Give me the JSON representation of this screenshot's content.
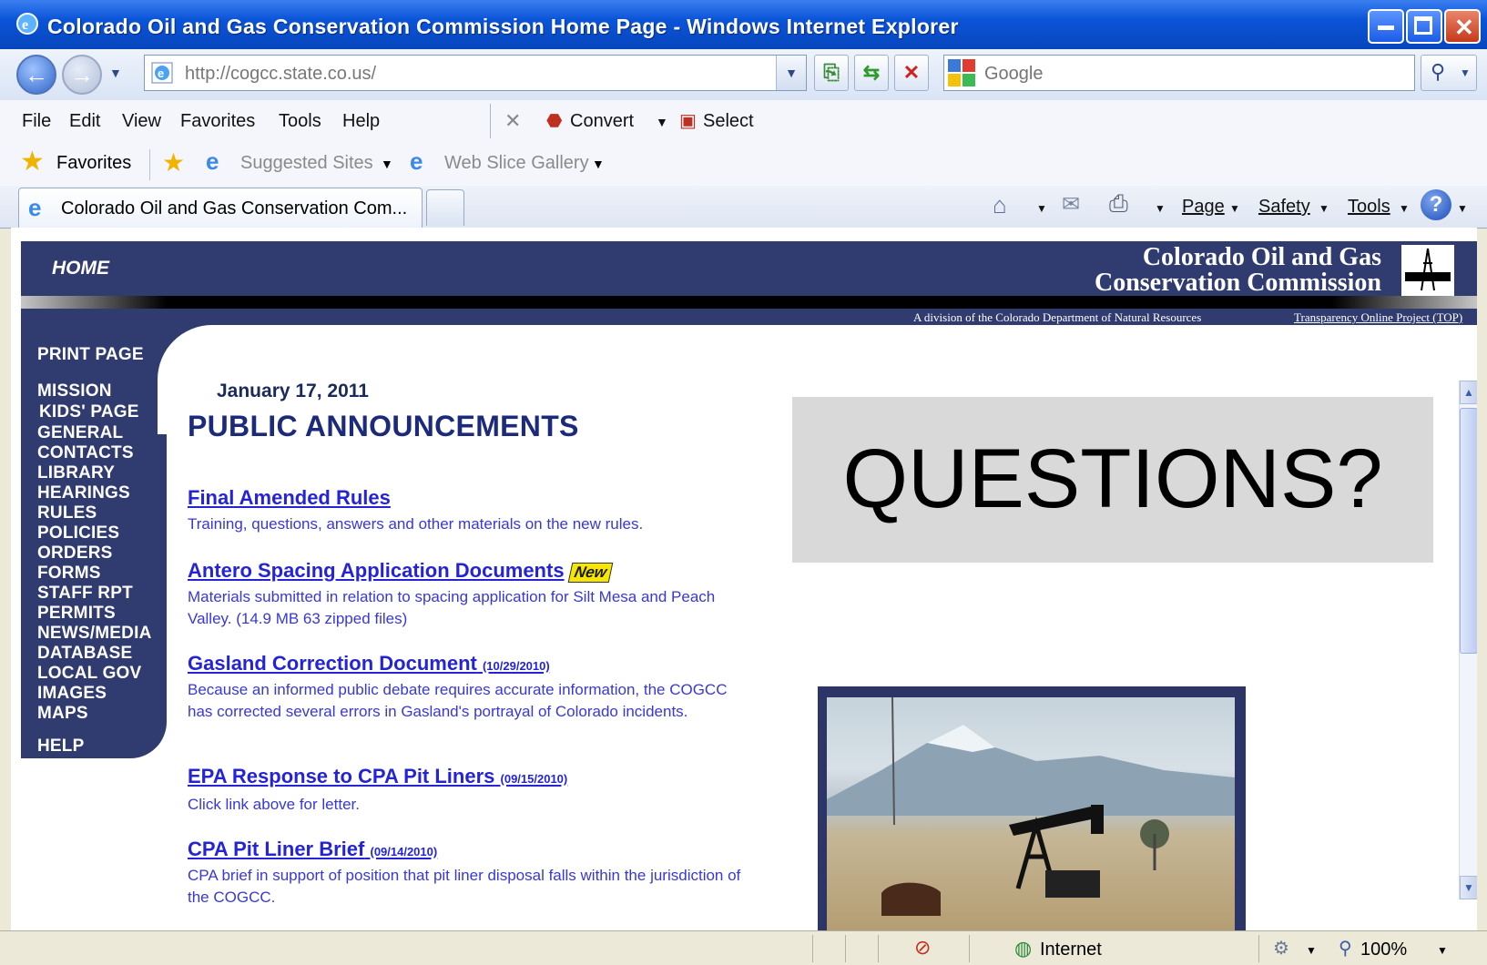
{
  "window": {
    "title": "Colorado Oil and Gas Conservation Commission Home Page - Windows Internet Explorer"
  },
  "address": {
    "url": "http://cogcc.state.co.us/",
    "search_placeholder": "Google"
  },
  "menu": [
    "File",
    "Edit",
    "View",
    "Favorites",
    "Tools",
    "Help"
  ],
  "toolbar2": {
    "convert": "Convert",
    "select": "Select"
  },
  "favorites_bar": {
    "favorites": "Favorites",
    "suggested": "Suggested Sites",
    "webslice": "Web Slice Gallery"
  },
  "tab": {
    "label": "Colorado Oil and Gas Conservation Com..."
  },
  "commandbar": {
    "page": "Page",
    "safety": "Safety",
    "tools": "Tools"
  },
  "banner": {
    "home": "HOME",
    "org_line1": "Colorado Oil and Gas",
    "org_line2": "Conservation Commission",
    "division": "A division of the Colorado Department of Natural Resources",
    "top_link": "Transparency Online Project (TOP)"
  },
  "sidenav": [
    "PRINT PAGE",
    "MISSION",
    "KIDS' PAGE",
    "GENERAL",
    "CONTACTS",
    "LIBRARY",
    "HEARINGS",
    "RULES",
    "POLICIES",
    "ORDERS",
    "FORMS",
    "STAFF RPT",
    "PERMITS",
    "NEWS/MEDIA",
    "DATABASE",
    "LOCAL GOV",
    "IMAGES",
    "MAPS",
    "HELP"
  ],
  "main": {
    "date": "January 17, 2011",
    "title": "PUBLIC ANNOUNCEMENTS",
    "items": [
      {
        "link": "Final Amended Rules",
        "date": "",
        "desc": "Training, questions, answers and other materials on the new rules."
      },
      {
        "link": "Antero Spacing Application Documents",
        "date": "",
        "badge": "New",
        "desc": "Materials submitted in relation to spacing application for Silt Mesa and Peach Valley. (14.9 MB 63 zipped files)"
      },
      {
        "link": "Gasland Correction Document",
        "date": "(10/29/2010)",
        "desc": "Because an informed public debate requires accurate information, the COGCC has corrected several errors in Gasland's portrayal of Colorado incidents."
      },
      {
        "link": "EPA Response to CPA Pit Liners",
        "date": "(09/15/2010)",
        "desc": "Click link above for letter."
      },
      {
        "link": "CPA Pit Liner Brief",
        "date": "(09/14/2010)",
        "desc": "CPA brief in support of position that pit liner disposal falls within the jurisdiction of the COGCC."
      }
    ]
  },
  "questions": "QUESTIONS?",
  "status": {
    "zone": "Internet",
    "zoom": "100%"
  },
  "colors": {
    "nav": "#303b70",
    "link": "#2424d6",
    "titlebar": "#0a54d8"
  }
}
